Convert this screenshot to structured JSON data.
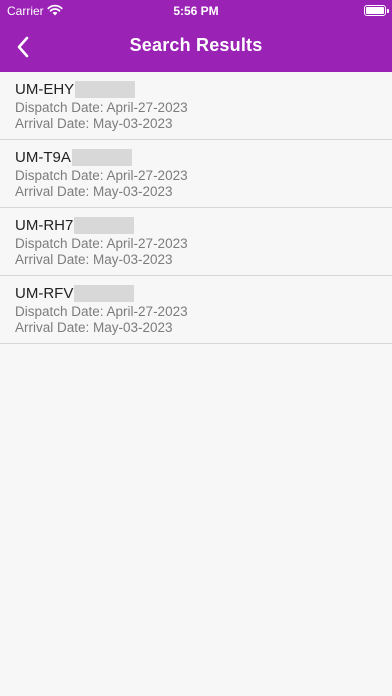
{
  "status_bar": {
    "carrier": "Carrier",
    "time": "5:56 PM"
  },
  "header": {
    "title": "Search Results",
    "background_color": "#9a22b4"
  },
  "results": [
    {
      "id": "UM-EHY",
      "dispatch": "Dispatch Date: April-27-2023",
      "arrival": "Arrival Date: May-03-2023"
    },
    {
      "id": "UM-T9A",
      "dispatch": "Dispatch Date: April-27-2023",
      "arrival": "Arrival Date: May-03-2023"
    },
    {
      "id": "UM-RH7",
      "dispatch": "Dispatch Date: April-27-2023",
      "arrival": "Arrival Date: May-03-2023"
    },
    {
      "id": "UM-RFV",
      "dispatch": "Dispatch Date: April-27-2023",
      "arrival": "Arrival Date: May-03-2023"
    }
  ]
}
